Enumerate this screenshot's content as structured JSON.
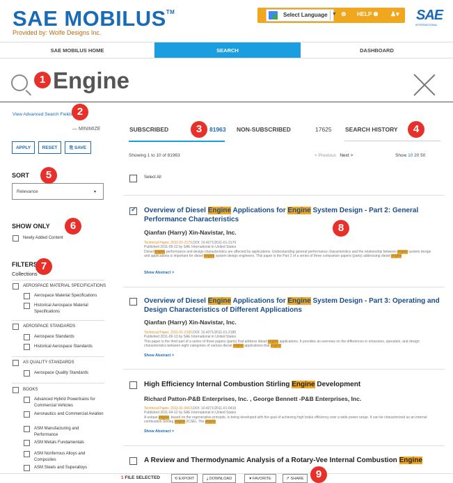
{
  "header": {
    "logo_text": "SAE MOBILUS",
    "logo_tm": "TM",
    "provided_by": "Provided by: Wolfe Designs Inc.",
    "language_label": "Select Language",
    "language_arrow": "▼",
    "rss_icon": "rss-icon",
    "rss_glyph": "⊜",
    "help_label": "HELP ❷",
    "user_glyph": "♟▾",
    "sae_mark": "SAE",
    "sae_sub": "INTERNATIONAL",
    "accent_color": "#f0a71d"
  },
  "nav": {
    "home": "SAE MOBILUS HOME",
    "search": "SEARCH",
    "dashboard": "DASHBOARD",
    "active_color": "#1a9ee0"
  },
  "search": {
    "query": "Engine",
    "advanced_link": "View Advanced Search Fields"
  },
  "badges": [
    "1",
    "2",
    "3",
    "4",
    "5",
    "6",
    "7",
    "8",
    "9"
  ],
  "sidebar": {
    "minimize": "— MINIMIZE",
    "apply": "APPLY",
    "reset": "RESET",
    "save": "⎘ SAVE",
    "sort_label": "SORT",
    "sort_value": "Relevance",
    "sort_caret": "▾",
    "show_only_label": "SHOW ONLY",
    "newly_added": "Newly Added Content",
    "filters_label": "FILTERS",
    "collections_label": "Collections",
    "groups": [
      {
        "name": "AEROSPACE MATERIAL SPECIFICATIONS",
        "items": [
          "Aerospace Material Specifications",
          "Historical Aerospace Material Specifications"
        ]
      },
      {
        "name": "AEROSPACE STANDARDS",
        "items": [
          "Aerospace Standards",
          "Historical Aerospace Standards"
        ]
      },
      {
        "name": "AS QUALITY STANDARDS",
        "items": [
          "Aerospace Quality Standards"
        ]
      },
      {
        "name": "BOOKS",
        "items": [
          "Advanced Hybrid Powertrains for Commercial Vehicles",
          "Aeronautics and Commercial Aviation",
          "ASM Manufacturing and Performance",
          "ASM Metals Fundamentals",
          "ASM Nonferrous Alloys and Composites",
          "ASM Steels and Superalloys"
        ]
      }
    ]
  },
  "tabs": {
    "subscribed": "SUBSCRIBED",
    "subscribed_count": "81963",
    "non_subscribed": "NON-SUBSCRIBED",
    "non_subscribed_count": "17625",
    "history": "SEARCH HISTORY"
  },
  "results_bar": {
    "showing": "Showing 1 to 10 of 81963",
    "previous": "< Previous",
    "next": "Next >",
    "show_label": "Show",
    "show_10": "10",
    "show_20": "20",
    "show_50": "50",
    "select_all": "Select All"
  },
  "results": [
    {
      "checked": true,
      "title_parts": [
        "Overview of Diesel ",
        "Engine",
        " Applications for ",
        "Engine",
        " System Design - Part 2: General Performance Characteristics"
      ],
      "authors": "Qianfan (Harry) Xin-Navistar, Inc.",
      "type": "Technical Paper, 2011-01-2179",
      "doi": ",DOI: 10.4271/2011-01-2179",
      "published": "Published 2011-09-13 by SAE International in United States",
      "abstract_parts": [
        "Diesel ",
        "engine",
        " performance and design characteristics are affected by applications. Understanding general performance characteristics and the relationship between ",
        "engine",
        " system design and applications is important for diesel ",
        "engine",
        " system design engineers. This paper is the Part 2 of a series of three companion papers (parts) addressing diesel ",
        "engine"
      ],
      "show_abstract": "Show Abstract >"
    },
    {
      "checked": false,
      "title_parts": [
        "Overview of Diesel ",
        "Engine",
        " Applications for ",
        "Engine",
        " System Design - Part 3: Operating and Design Characteristics of Different Applications"
      ],
      "authors": "Qianfan (Harry) Xin-Navistar, Inc.",
      "type": "Technical Paper, 2011-01-2180",
      "doi": ",DOI: 10.4271/2011-01-2180",
      "published": "Published 2011-09-13 by SAE International in United States",
      "abstract_parts": [
        "This paper is the third part of a series of three papers (parts) that address diesel ",
        "engine",
        " applications. It provides an overview on the differences in emissions, operation, and design characteristics between eight categories of various diesel ",
        "engine",
        " applications that ",
        "engine"
      ],
      "show_abstract": "Show Abstract >"
    },
    {
      "checked": false,
      "title_parts": [
        "High Efficiency Internal Combustion Stirling ",
        "Engine",
        " Development"
      ],
      "authors": "Richard Patton-P&B Enterprises, Inc. , George Bennett -P&B Enterprises, Inc.",
      "type": "Technical Paper, 2011-01-0410",
      "doi": ",DOI: 10.4271/2011-01-0410",
      "published": "Published 2011-04-12 by SAE International in United States",
      "abstract_parts": [
        "A unique ",
        "engine",
        ", based on the regenerative principle, is being developed with the goal of achieving high brake efficiency over a wide power range. It can be characterized as an internal combustion Stirling ",
        "engine",
        " (ICSE). The ",
        "engine"
      ],
      "show_abstract": "Show Abstract >"
    },
    {
      "checked": false,
      "title_parts": [
        "A Review and Thermodynamic Analysis of a Rotary-Vee Internal Combustion ",
        "Engine"
      ],
      "authors": "",
      "type": "",
      "doi": "",
      "published": "",
      "abstract_parts": [],
      "show_abstract": ""
    }
  ],
  "bottom_bar": {
    "count": "1",
    "selected": " FILE SELECTED",
    "export": "⟲ EXPORT",
    "download": "⤓ DOWNLOAD",
    "favorite": "♥ FAVORITE",
    "share": "↱ SHARE"
  }
}
